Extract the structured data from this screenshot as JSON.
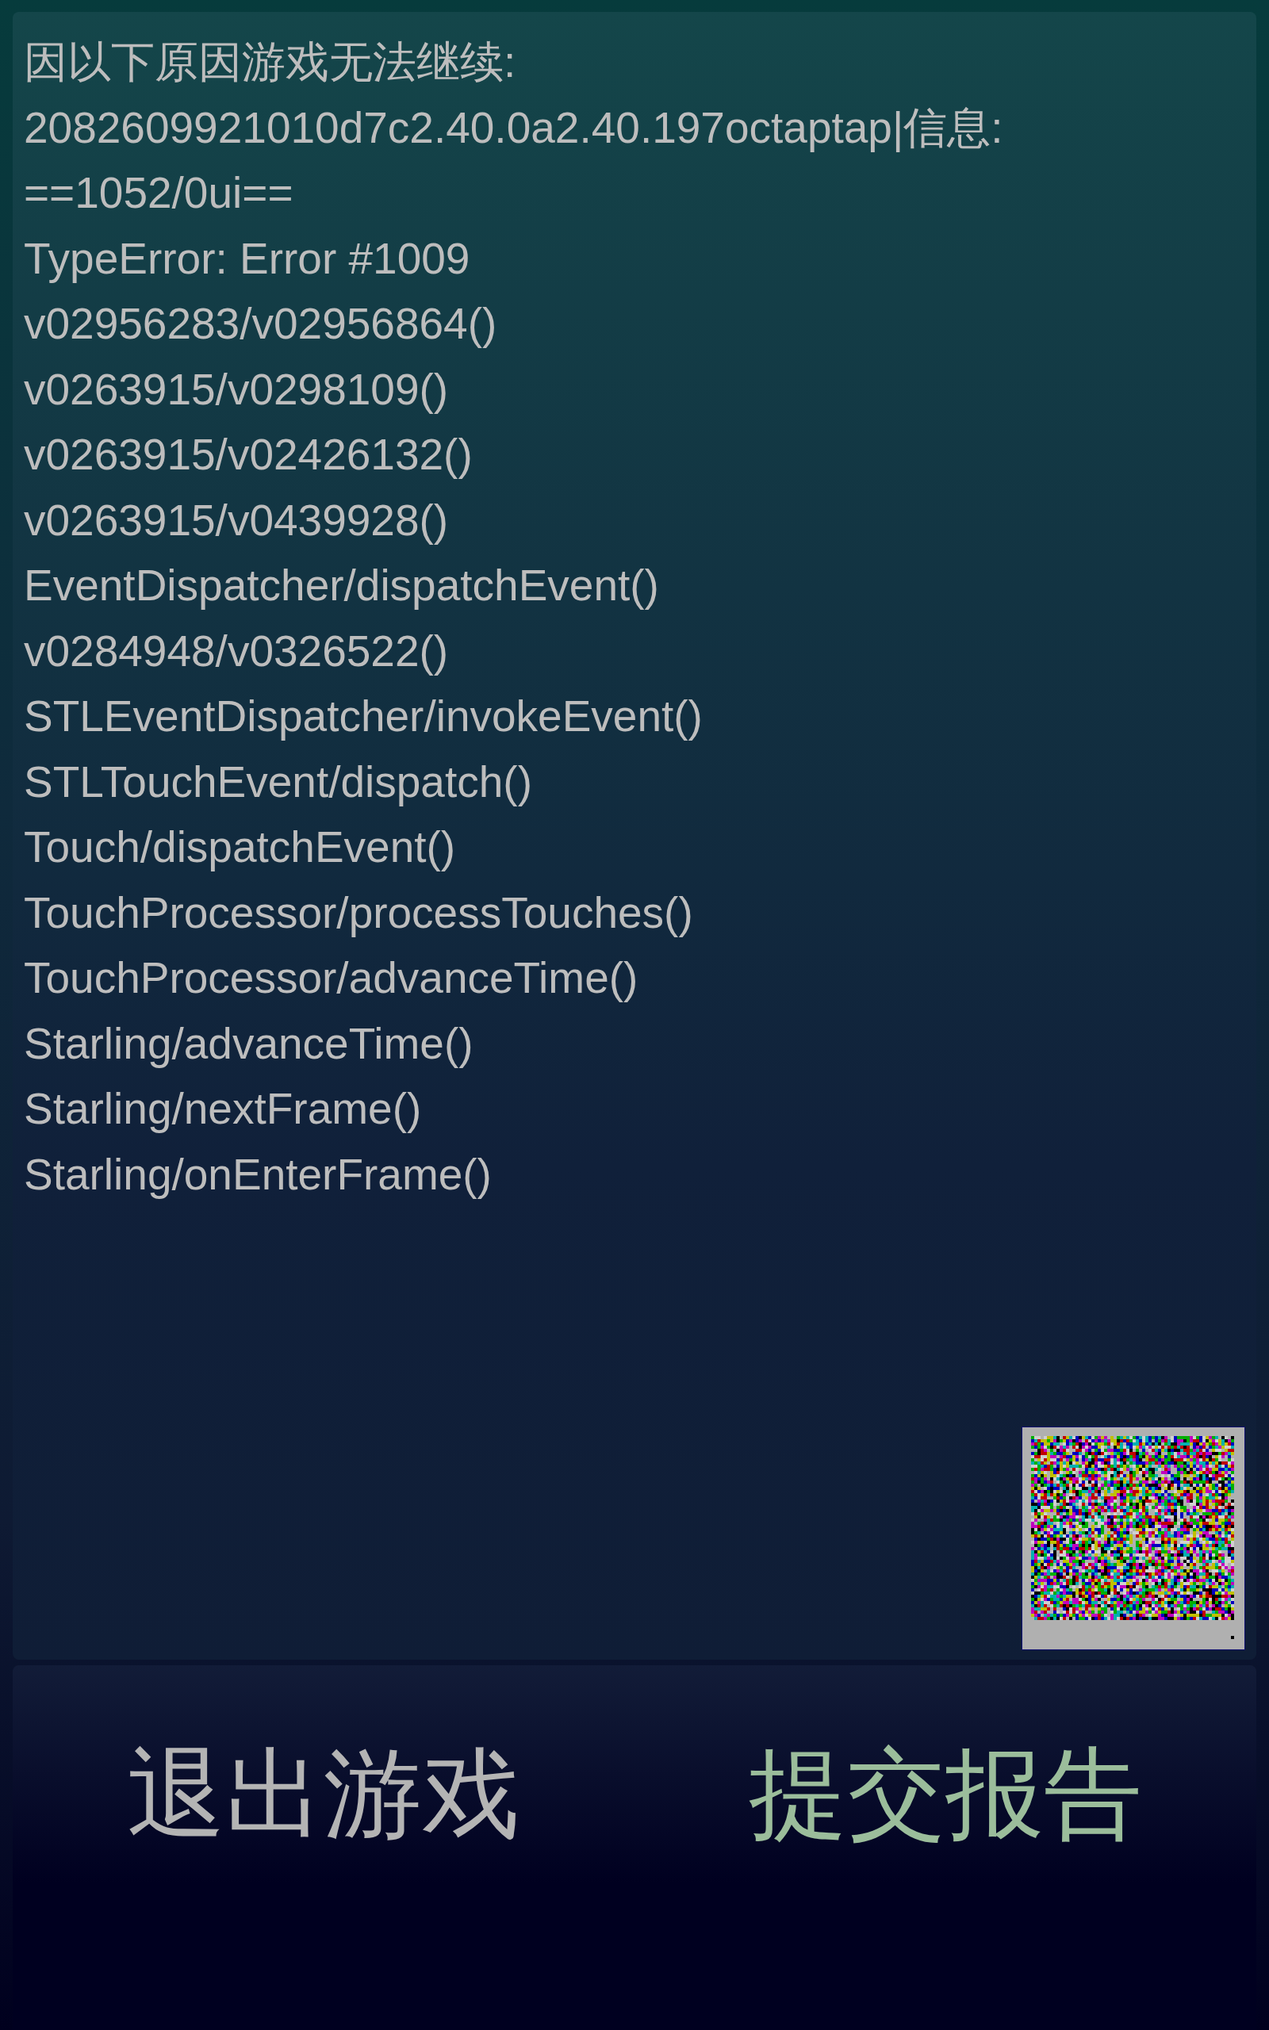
{
  "error_report": {
    "lines": [
      "因以下原因游戏无法继续:",
      "2082609921010d7c2.40.0a2.40.197octaptap|信息:",
      "==1052/0ui==",
      "TypeError: Error #1009",
      "v02956283/v02956864()",
      "v0263915/v0298109()",
      "v0263915/v02426132()",
      "v0263915/v0439928()",
      "EventDispatcher/dispatchEvent()",
      "v0284948/v0326522()",
      "STLEventDispatcher/invokeEvent()",
      "STLTouchEvent/dispatch()",
      "Touch/dispatchEvent()",
      "TouchProcessor/processTouches()",
      "TouchProcessor/advanceTime()",
      "Starling/advanceTime()",
      "Starling/nextFrame()",
      "Starling/onEnterFrame()"
    ]
  },
  "buttons": [
    {
      "label": "退出游戏",
      "kind": "normal"
    },
    {
      "label": "提交报告",
      "kind": "primary"
    }
  ]
}
